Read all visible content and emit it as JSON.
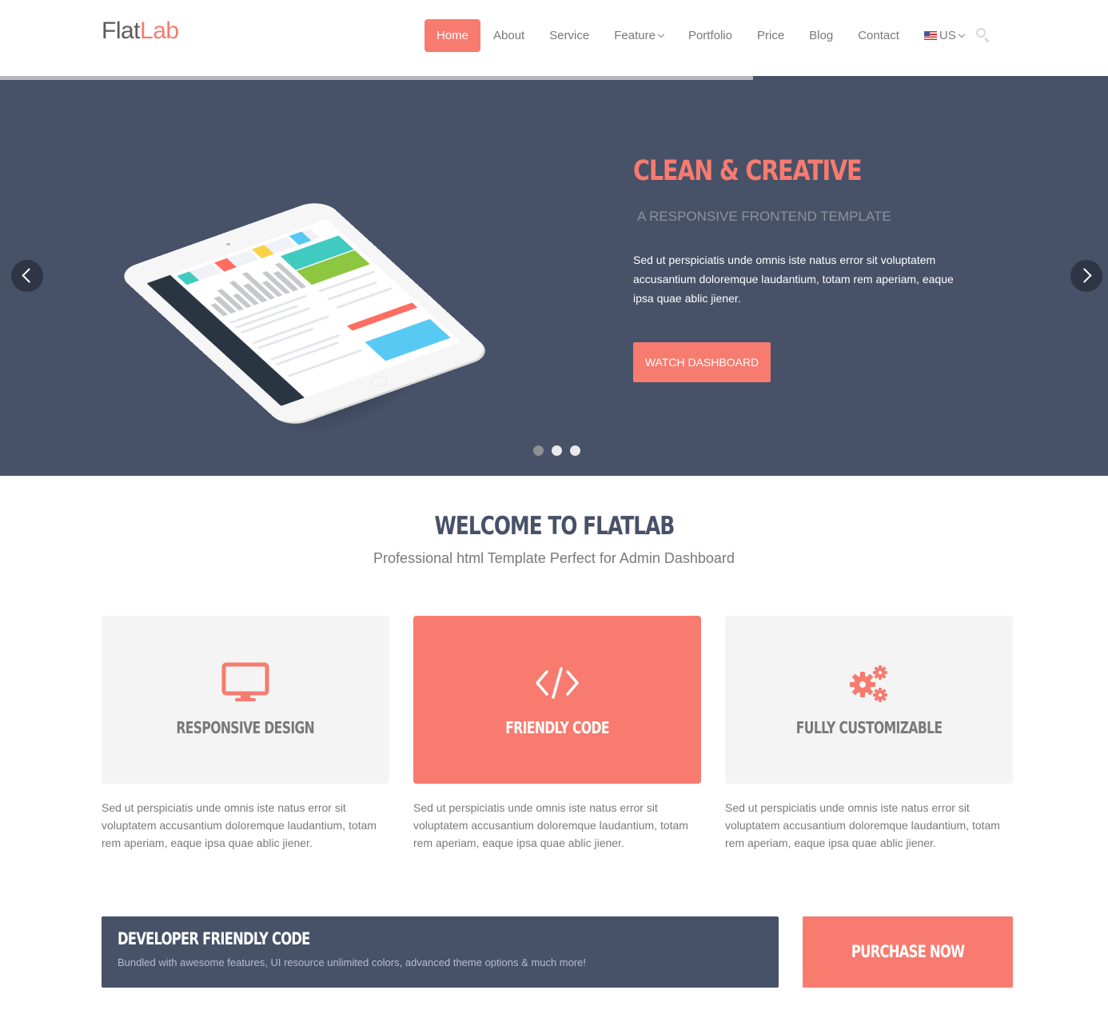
{
  "brand": {
    "name_part1": "Flat",
    "name_part2": "Lab"
  },
  "nav": {
    "home": "Home",
    "about": "About",
    "service": "Service",
    "feature": "Feature",
    "portfolio": "Portfolio",
    "price": "Price",
    "blog": "Blog",
    "contact": "Contact",
    "language": "US"
  },
  "hero": {
    "title": "CLEAN & CREATIVE",
    "subtitle": "A RESPONSIVE FRONTEND TEMPLATE",
    "text": "Sed ut perspiciatis unde omnis iste natus error sit voluptatem accusantium doloremque laudantium, totam rem aperiam, eaque ipsa quae ablic jiener.",
    "button": "WATCH DASHBOARD",
    "slide_progress": 0.68,
    "active_dot": 1,
    "dot_count": 3
  },
  "welcome": {
    "title": "WELCOME TO FLATLAB",
    "subtitle": "Professional html Template Perfect for Admin Dashboard"
  },
  "features": [
    {
      "name": "RESPONSIVE DESIGN",
      "icon": "monitor-icon",
      "desc": "Sed ut perspiciatis unde omnis iste natus error sit voluptatem accusantium doloremque laudantium, totam rem aperiam, eaque ipsa quae ablic jiener."
    },
    {
      "name": "FRIENDLY CODE",
      "icon": "code-icon",
      "desc": "Sed ut perspiciatis unde omnis iste natus error sit voluptatem accusantium doloremque laudantium, totam rem aperiam, eaque ipsa quae ablic jiener."
    },
    {
      "name": "FULLY CUSTOMIZABLE",
      "icon": "gears-icon",
      "desc": "Sed ut perspiciatis unde omnis iste natus error sit voluptatem accusantium doloremque laudantium, totam rem aperiam, eaque ipsa quae ablic jiener."
    }
  ],
  "banner": {
    "title": "DEVELOPER FRIENDLY CODE",
    "text": "Bundled with awesome features, UI resource unlimited colors, advanced theme options & much more!",
    "purchase": "PURCHASE NOW"
  },
  "colors": {
    "accent": "#f77b6f",
    "hero_bg": "#475168",
    "text": "#797979",
    "tile_bg": "#f4f4f4"
  }
}
